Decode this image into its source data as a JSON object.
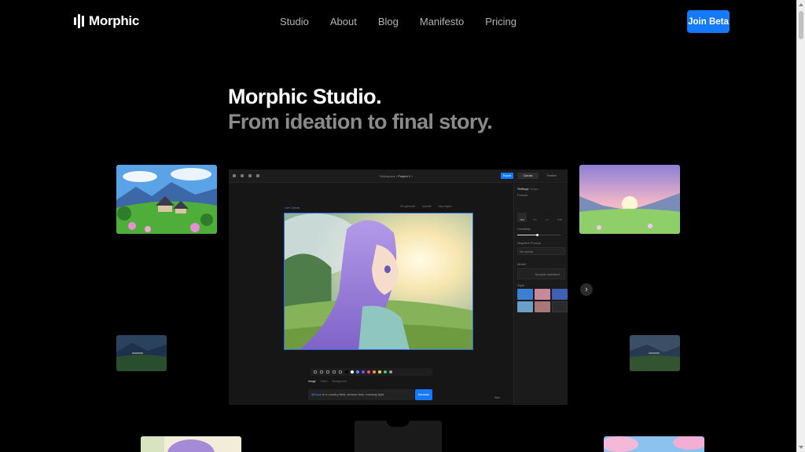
{
  "brand": {
    "name": "Morphic"
  },
  "nav": [
    "Studio",
    "About",
    "Blog",
    "Manifesto",
    "Pricing"
  ],
  "cta": {
    "label": "Join Beta"
  },
  "hero": {
    "title": "Morphic Studio.",
    "subtitle": "From ideation to final story."
  },
  "app": {
    "breadcrumb": {
      "workspace": "Workspace",
      "project": "Project 1"
    },
    "export_label": "Export",
    "panel_tabs": [
      {
        "label": "Canvas",
        "active": true
      },
      {
        "label": "Timeline",
        "active": false
      }
    ],
    "canvas_label": "Live Canvas",
    "canvas_actions": [
      "Re-generate",
      "Upscale",
      "Vary region"
    ],
    "settings": {
      "title": "Settings",
      "subtitle": "Image",
      "aspect_label": "Format",
      "aspects": [
        {
          "label": "16:9",
          "selected": true
        },
        {
          "label": "4:3",
          "selected": false
        },
        {
          "label": "1:1",
          "selected": false
        },
        {
          "label": "9:16",
          "selected": false
        }
      ],
      "creativity_label": "Creativity",
      "creativity_value": 0.45,
      "negative_label": "Negative Prompt",
      "negative_placeholder": "No words",
      "model_label": "Model",
      "model_value": "Morphic standard",
      "style_label": "Style"
    },
    "toolbar": {
      "palette": [
        "#000000",
        "#ffffff",
        "#5b8cff",
        "#7d4dff",
        "#ff4d6d",
        "#ff9a3c",
        "#ffd23c",
        "#3ccf6a",
        "#9a9a9a"
      ]
    },
    "prompt_tabs": [
      {
        "label": "Image",
        "active": true
      },
      {
        "label": "Video",
        "active": false
      },
      {
        "label": "Background",
        "active": false
      }
    ],
    "prompt": {
      "subject": "@Suzy",
      "text": " in a country field, serious face, morning light"
    },
    "generate_label": "Generate",
    "zoom": "58%"
  }
}
